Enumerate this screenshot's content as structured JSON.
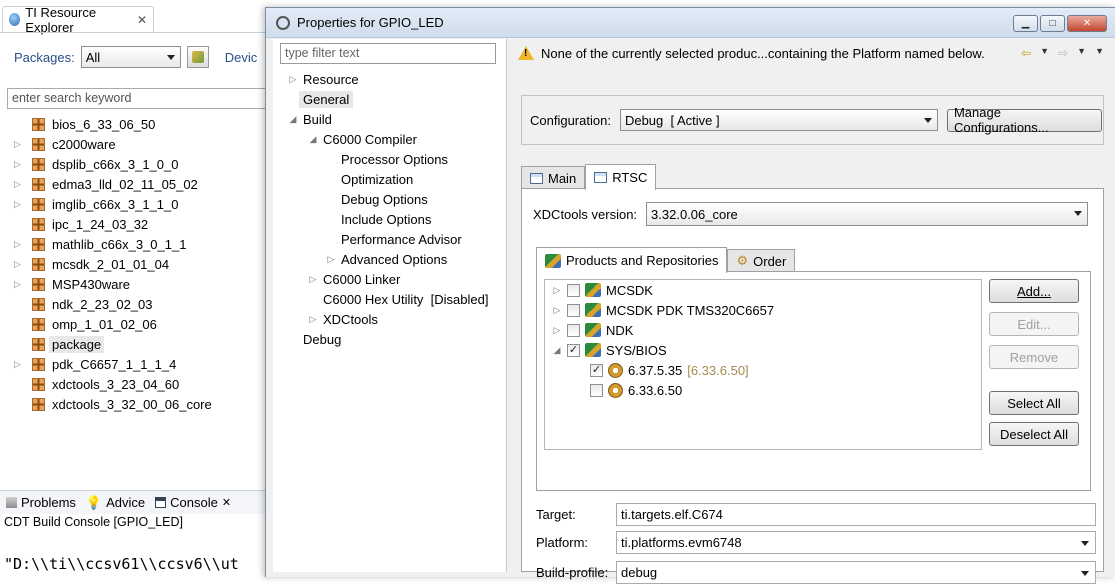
{
  "explorer": {
    "tab_title": "TI Resource Explorer",
    "packages_label": "Packages:",
    "packages_value": "All",
    "devices_label": "Devic",
    "search_placeholder": "enter search keyword",
    "packages": [
      {
        "label": "bios_6_33_06_50",
        "expandable": false,
        "selected": false
      },
      {
        "label": "c2000ware",
        "expandable": true,
        "selected": false
      },
      {
        "label": "dsplib_c66x_3_1_0_0",
        "expandable": true,
        "selected": false
      },
      {
        "label": "edma3_lld_02_11_05_02",
        "expandable": true,
        "selected": false
      },
      {
        "label": "imglib_c66x_3_1_1_0",
        "expandable": true,
        "selected": false
      },
      {
        "label": "ipc_1_24_03_32",
        "expandable": false,
        "selected": false
      },
      {
        "label": "mathlib_c66x_3_0_1_1",
        "expandable": true,
        "selected": false
      },
      {
        "label": "mcsdk_2_01_01_04",
        "expandable": true,
        "selected": false
      },
      {
        "label": "MSP430ware",
        "expandable": true,
        "selected": false
      },
      {
        "label": "ndk_2_23_02_03",
        "expandable": false,
        "selected": false
      },
      {
        "label": "omp_1_01_02_06",
        "expandable": false,
        "selected": false
      },
      {
        "label": "package",
        "expandable": false,
        "selected": true
      },
      {
        "label": "pdk_C6657_1_1_1_4",
        "expandable": true,
        "selected": false
      },
      {
        "label": "xdctools_3_23_04_60",
        "expandable": false,
        "selected": false
      },
      {
        "label": "xdctools_3_32_00_06_core",
        "expandable": false,
        "selected": false
      }
    ]
  },
  "console": {
    "tabs": [
      "Problems",
      "Advice",
      "Console"
    ],
    "title": "CDT Build Console [GPIO_LED]",
    "line": "\"D:\\\\ti\\\\ccsv61\\\\ccsv6\\\\ut"
  },
  "dialog": {
    "title": "Properties for GPIO_LED",
    "filter_placeholder": "type filter text",
    "message": "None of the currently selected produc...containing the Platform named below.",
    "tree": [
      {
        "label": "Resource",
        "indent": 0,
        "toggle": "▷",
        "selected": false
      },
      {
        "label": "General",
        "indent": 0,
        "toggle": "",
        "selected": true
      },
      {
        "label": "Build",
        "indent": 0,
        "toggle": "◢",
        "selected": false
      },
      {
        "label": "C6000 Compiler",
        "indent": 1,
        "toggle": "◢",
        "selected": false
      },
      {
        "label": "Processor Options",
        "indent": 2,
        "toggle": "",
        "selected": false
      },
      {
        "label": "Optimization",
        "indent": 2,
        "toggle": "",
        "selected": false
      },
      {
        "label": "Debug Options",
        "indent": 2,
        "toggle": "",
        "selected": false
      },
      {
        "label": "Include Options",
        "indent": 2,
        "toggle": "",
        "selected": false
      },
      {
        "label": "Performance Advisor",
        "indent": 2,
        "toggle": "",
        "selected": false
      },
      {
        "label": "Advanced Options",
        "indent": 2,
        "toggle": "▷",
        "selected": false
      },
      {
        "label": "C6000 Linker",
        "indent": 1,
        "toggle": "▷",
        "selected": false
      },
      {
        "label": "C6000 Hex Utility  [Disabled]",
        "indent": 1,
        "toggle": "",
        "selected": false
      },
      {
        "label": "XDCtools",
        "indent": 1,
        "toggle": "▷",
        "selected": false
      },
      {
        "label": "Debug",
        "indent": 0,
        "toggle": "",
        "selected": false
      }
    ],
    "configuration_label": "Configuration:",
    "configuration_value": "Debug  [ Active ]",
    "manage_button": "Manage Configurations...",
    "tabs": [
      "Main",
      "RTSC"
    ],
    "active_tab": "RTSC",
    "xdc_label": "XDCtools version:",
    "xdc_value": "3.32.0.06_core",
    "inner_tabs": [
      "Products and Repositories",
      "Order"
    ],
    "products": [
      {
        "label": "MCSDK",
        "level": 0,
        "toggle": "▷",
        "checked": false,
        "icon": "product-icon",
        "hint": ""
      },
      {
        "label": "MCSDK PDK TMS320C6657",
        "level": 0,
        "toggle": "▷",
        "checked": false,
        "icon": "product-icon",
        "hint": ""
      },
      {
        "label": "NDK",
        "level": 0,
        "toggle": "▷",
        "checked": false,
        "icon": "product-icon",
        "hint": ""
      },
      {
        "label": "SYS/BIOS",
        "level": 0,
        "toggle": "◢",
        "checked": true,
        "icon": "product-icon",
        "hint": ""
      },
      {
        "label": "6.37.5.35",
        "level": 1,
        "toggle": "",
        "checked": true,
        "icon": "gear-icon",
        "hint": "[6.33.6.50]"
      },
      {
        "label": "6.33.6.50",
        "level": 1,
        "toggle": "",
        "checked": false,
        "icon": "gear-icon",
        "hint": ""
      }
    ],
    "buttons": {
      "add": "Add...",
      "edit": "Edit...",
      "remove": "Remove",
      "select_all": "Select All",
      "deselect_all": "Deselect All"
    },
    "target_label": "Target:",
    "target_value": "ti.targets.elf.C674",
    "platform_label": "Platform:",
    "platform_value": "ti.platforms.evm6748",
    "build_profile_label": "Build-profile:",
    "build_profile_value": "debug"
  }
}
